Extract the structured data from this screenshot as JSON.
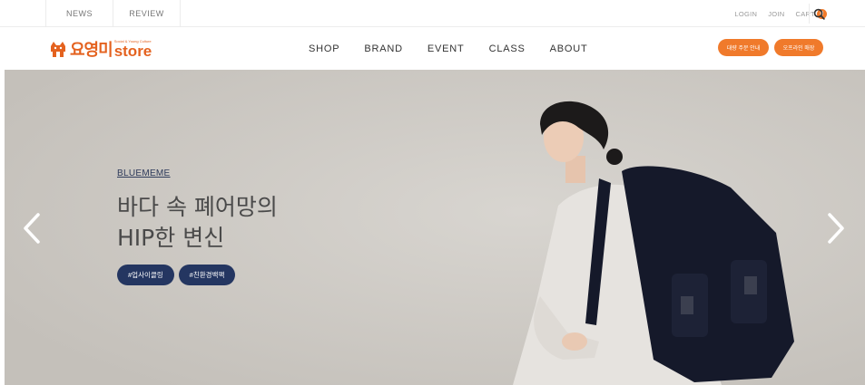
{
  "topbar": {
    "left_links": [
      "NEWS",
      "REVIEW"
    ],
    "login": "LOGIN",
    "join": "JOIN",
    "cart": "CART",
    "cart_count": "0"
  },
  "logo": {
    "korean": "요영미",
    "tagline": "Social & Young Culture",
    "english": "store"
  },
  "nav": {
    "items": [
      "SHOP",
      "BRAND",
      "EVENT",
      "CLASS",
      "ABOUT"
    ]
  },
  "buttons": {
    "bulk_order": "대량 주문 안내",
    "offline_store": "오프라인 매장"
  },
  "hero": {
    "brand": "BLUEMEME",
    "title_line1": "바다 속 폐어망의",
    "title_line2": "HIP한 변신",
    "tags": [
      "#업사이클링",
      "#친환경백팩"
    ]
  },
  "colors": {
    "accent": "#f07a2b",
    "tag_bg": "#243661",
    "hero_bg": "#cdc9c3"
  }
}
